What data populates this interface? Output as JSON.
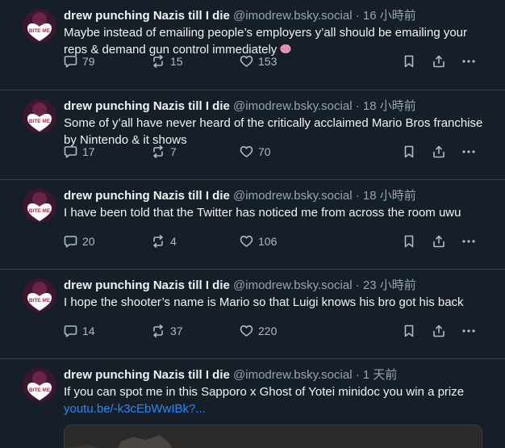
{
  "posts": [
    {
      "author": "drew punching Nazis till I die",
      "handle": "@imodrew.bsky.social",
      "time": "16 小時前",
      "text": "Maybe instead of emailing people’s employers y’all should be emailing your reps & demand gun control immediately",
      "replies": "79",
      "reposts": "15",
      "likes": "153"
    },
    {
      "author": "drew punching Nazis till I die",
      "handle": "@imodrew.bsky.social",
      "time": "18 小時前",
      "text": "Some of y’all have never heard of the critically acclaimed Mario Bros franchise by Nintendo & it shows",
      "replies": "17",
      "reposts": "7",
      "likes": "70"
    },
    {
      "author": "drew punching Nazis till I die",
      "handle": "@imodrew.bsky.social",
      "time": "18 小時前",
      "text": "I have been told that the Twitter has noticed me from across the room uwu",
      "replies": "20",
      "reposts": "4",
      "likes": "106"
    },
    {
      "author": "drew punching Nazis till I die",
      "handle": "@imodrew.bsky.social",
      "time": "23 小時前",
      "text": "I hope the shooter’s name is Mario so that Luigi knows his bro got his back",
      "replies": "14",
      "reposts": "37",
      "likes": "220"
    },
    {
      "author": "drew punching Nazis till I die",
      "handle": "@imodrew.bsky.social",
      "time": "1 天前",
      "text": "If you can spot me in this Sapporo x Ghost of Yotei minidoc you win a prize",
      "link": "youtu.be/-k3cEbWwIBk?..."
    }
  ],
  "separator": "·",
  "avatar_text": "BITE ME",
  "colors": {
    "background": "#161e27",
    "border": "#2e4052",
    "muted": "#93a5b7",
    "link": "#208bfe",
    "avatar_bg": "#5a1e3c",
    "heart": "#ffffff"
  }
}
